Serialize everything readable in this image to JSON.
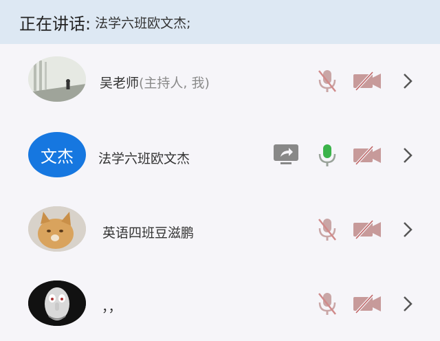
{
  "speaking": {
    "label": "正在讲话:",
    "name": "法学六班欧文杰;"
  },
  "participants": [
    {
      "name": "吴老师",
      "role": "(主持人, 我)",
      "mic": "muted",
      "camera": "off"
    },
    {
      "name": "法学六班欧文杰",
      "avatar_text": "文杰",
      "mic": "active",
      "camera": "off",
      "sharing": true
    },
    {
      "name": "英语四班豆滋鹏",
      "mic": "muted",
      "camera": "off"
    },
    {
      "name": "，，",
      "mic": "muted",
      "camera": "off"
    }
  ],
  "colors": {
    "header_bg": "#dde8f3",
    "avatar_blue": "#1677e0",
    "mic_active": "#3bb34a",
    "icon_muted": "#c79a9a"
  }
}
